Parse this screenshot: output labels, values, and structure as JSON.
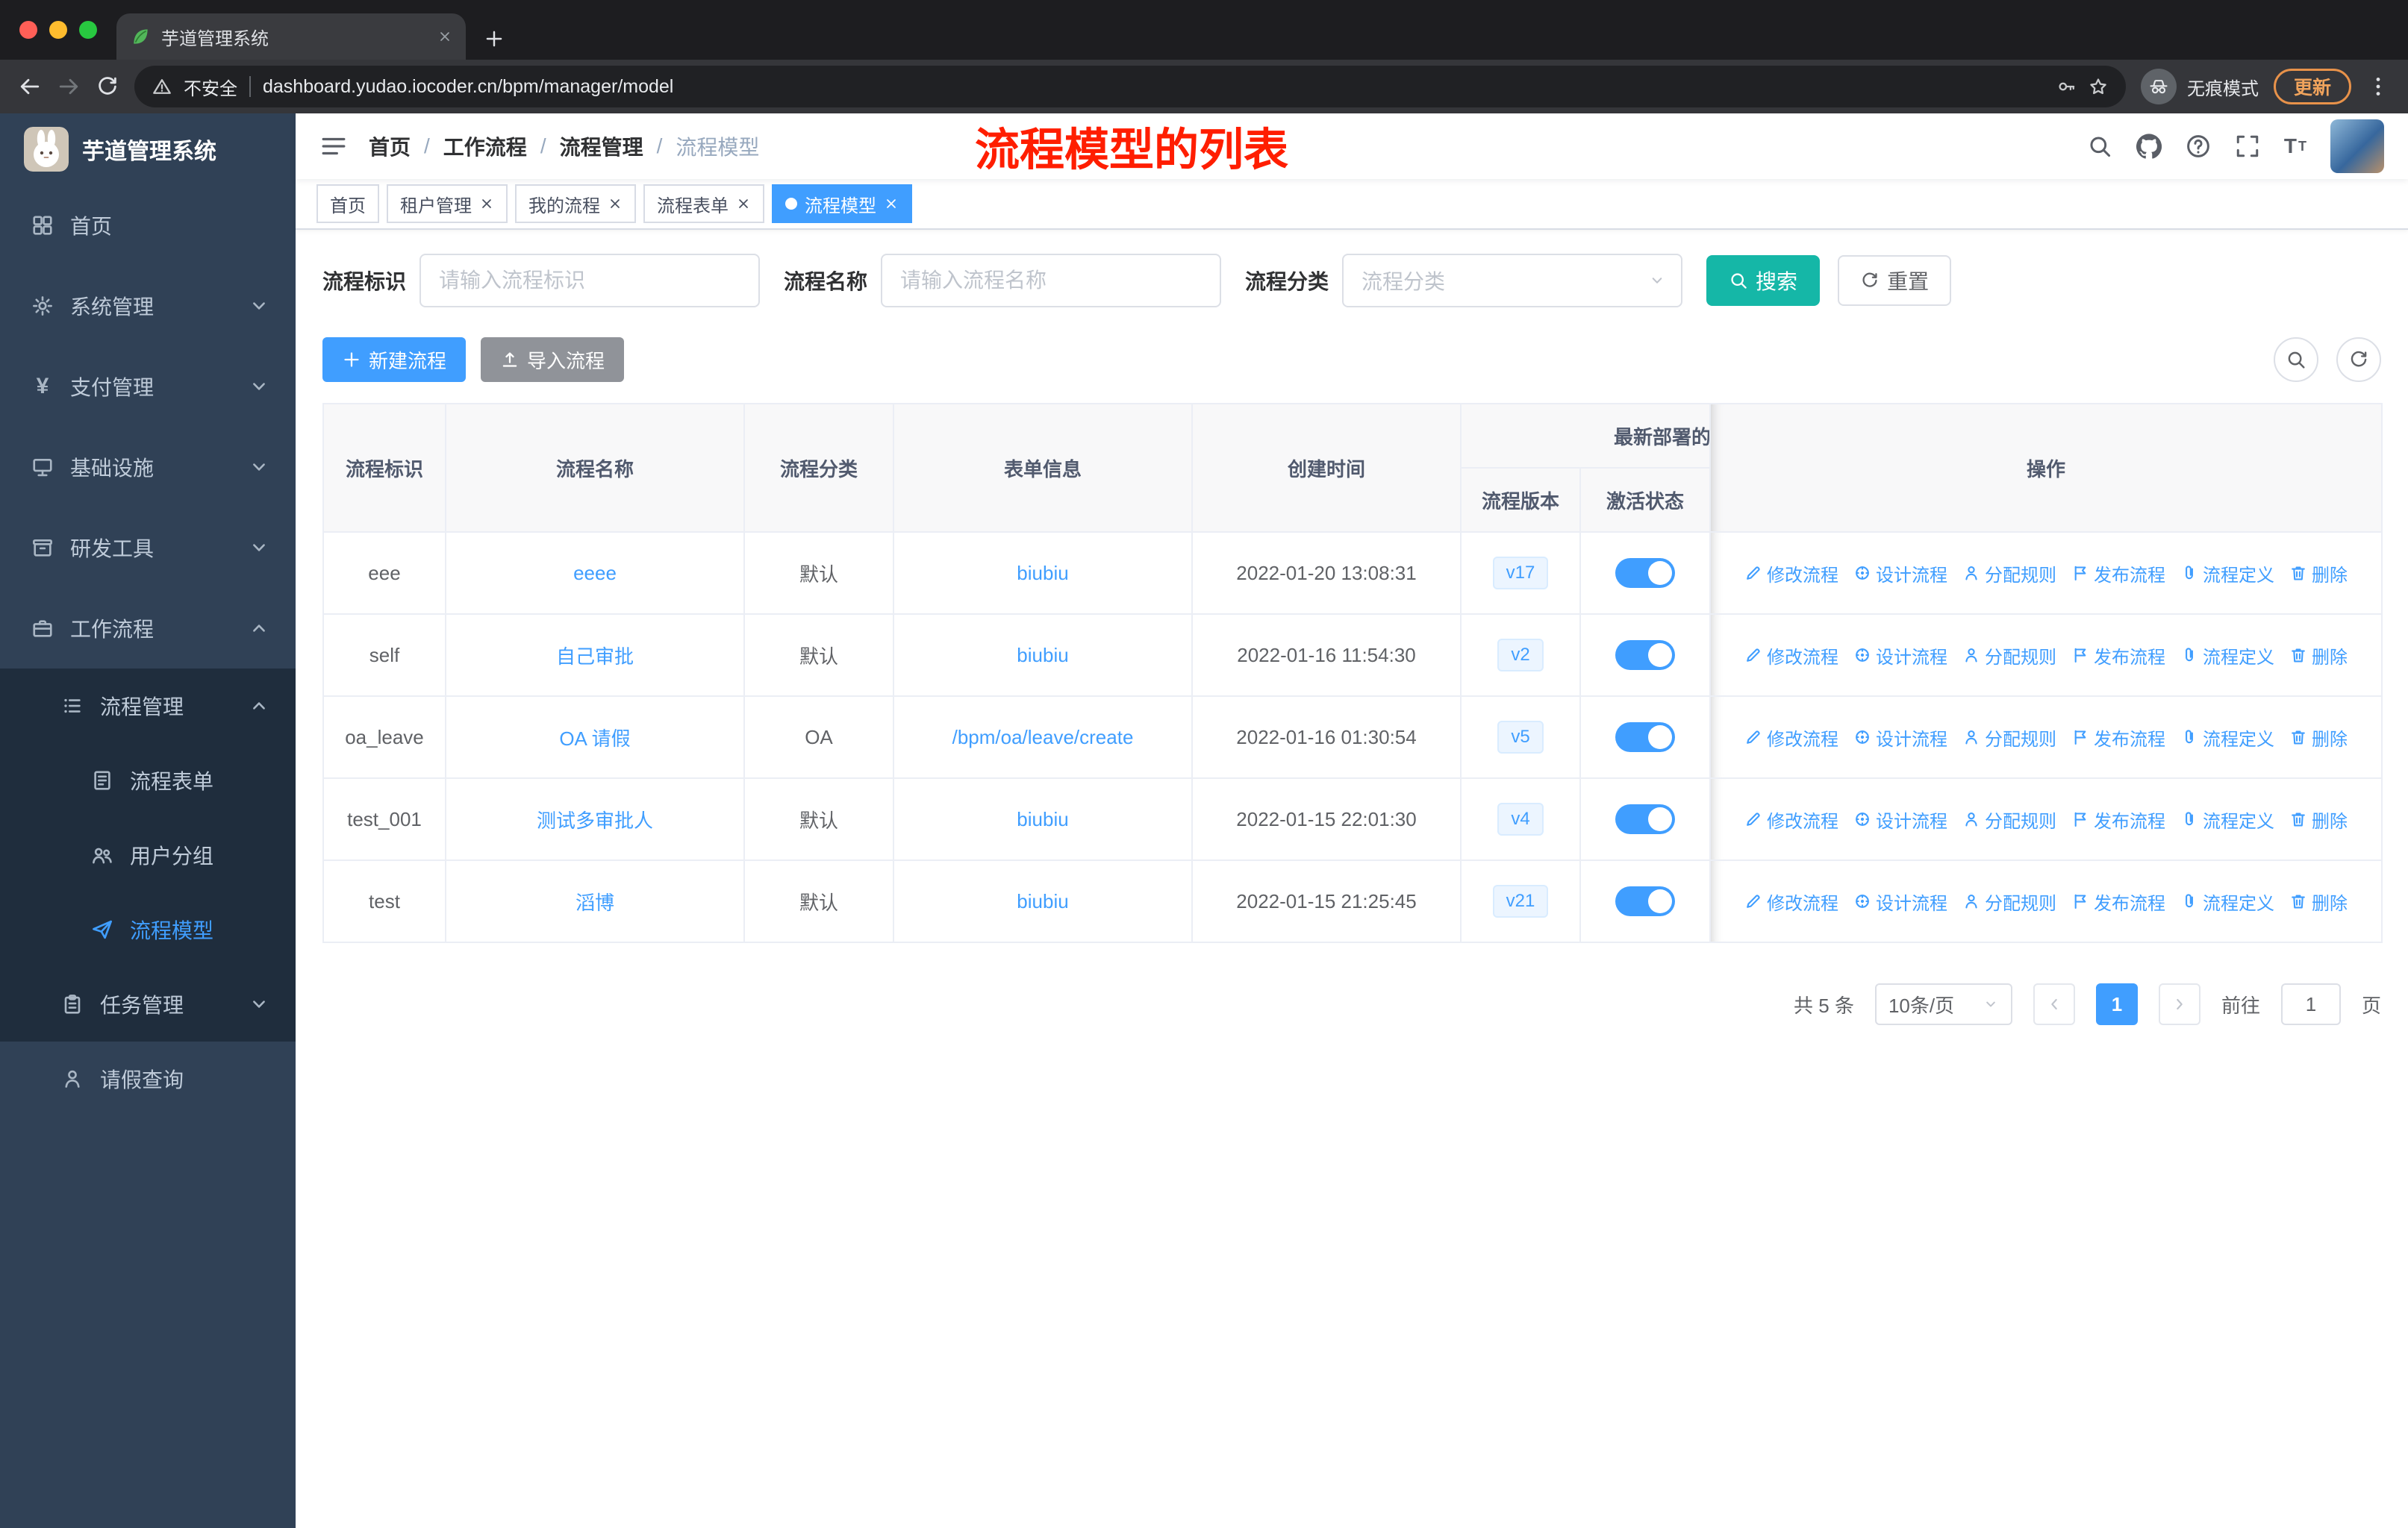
{
  "colors": {
    "accent": "#409eff",
    "search_button": "#15b7a7",
    "annotation_red": "#ff1e00",
    "sidebar_bg": "#304156",
    "submenu_bg": "#1f2d3d",
    "toggle_on": "#409eff",
    "tag_active": "#409eff"
  },
  "browser": {
    "tab_title": "芋道管理系统",
    "security_label": "不安全",
    "url": "dashboard.yudao.iocoder.cn/bpm/manager/model",
    "incognito_label": "无痕模式",
    "update_label": "更新"
  },
  "sidebar": {
    "logo_title": "芋道管理系统",
    "items": [
      {
        "key": "home",
        "label": "首页",
        "icon": "dashboard-icon",
        "level": 1
      },
      {
        "key": "system-management",
        "label": "系统管理",
        "icon": "gear-icon",
        "level": 1,
        "chevron": "down"
      },
      {
        "key": "payment-management",
        "label": "支付管理",
        "icon": "yen-icon",
        "level": 1,
        "chevron": "down"
      },
      {
        "key": "infrastructure",
        "label": "基础设施",
        "icon": "infra-icon",
        "level": 1,
        "chevron": "down"
      },
      {
        "key": "dev-tools",
        "label": "研发工具",
        "icon": "tools-icon",
        "level": 1,
        "chevron": "down"
      },
      {
        "key": "workflow",
        "label": "工作流程",
        "icon": "workflow-icon",
        "level": 1,
        "chevron": "up"
      },
      {
        "key": "process-management",
        "label": "流程管理",
        "icon": "process-icon",
        "level": 2,
        "dark": true,
        "chevron": "up"
      },
      {
        "key": "process-form",
        "label": "流程表单",
        "icon": "form-icon",
        "level": 3,
        "dark": true
      },
      {
        "key": "user-group",
        "label": "用户分组",
        "icon": "group-icon",
        "level": 3,
        "dark": true
      },
      {
        "key": "process-model",
        "label": "流程模型",
        "icon": "model-icon",
        "level": 3,
        "dark": true,
        "active": true
      },
      {
        "key": "task-management",
        "label": "任务管理",
        "icon": "task-icon",
        "level": 2,
        "dark": true,
        "chevron": "down"
      },
      {
        "key": "leave-query",
        "label": "请假查询",
        "icon": "person-icon",
        "level": 2
      }
    ]
  },
  "navbar": {
    "breadcrumb": [
      "首页",
      "工作流程",
      "流程管理",
      "流程模型"
    ],
    "annotation": "流程模型的列表"
  },
  "tags_bar": {
    "tags": [
      {
        "label": "首页",
        "closable": false,
        "active": false
      },
      {
        "label": "租户管理",
        "closable": true,
        "active": false
      },
      {
        "label": "我的流程",
        "closable": true,
        "active": false
      },
      {
        "label": "流程表单",
        "closable": true,
        "active": false
      },
      {
        "label": "流程模型",
        "closable": true,
        "active": true
      }
    ]
  },
  "filters": {
    "fields": [
      {
        "key": "process-id",
        "label": "流程标识",
        "placeholder": "请输入流程标识",
        "type": "input"
      },
      {
        "key": "process-name",
        "label": "流程名称",
        "placeholder": "请输入流程名称",
        "type": "input"
      },
      {
        "key": "process-category",
        "label": "流程分类",
        "placeholder": "流程分类",
        "type": "select"
      }
    ],
    "search_label": "搜索",
    "reset_label": "重置"
  },
  "toolbar": {
    "create_label": "新建流程",
    "import_label": "导入流程"
  },
  "table": {
    "columns": [
      "流程标识",
      "流程名称",
      "流程分类",
      "表单信息",
      "创建时间"
    ],
    "group_header": {
      "label": "最新部署的",
      "children": [
        "流程版本",
        "激活状态"
      ]
    },
    "actions_header": "操作",
    "row_actions": [
      {
        "key": "edit",
        "label": "修改流程",
        "icon": "edit-icon"
      },
      {
        "key": "design",
        "label": "设计流程",
        "icon": "design-icon"
      },
      {
        "key": "assign-rules",
        "label": "分配规则",
        "icon": "assign-icon"
      },
      {
        "key": "publish",
        "label": "发布流程",
        "icon": "publish-icon"
      },
      {
        "key": "definition",
        "label": "流程定义",
        "icon": "definition-icon"
      },
      {
        "key": "delete",
        "label": "删除",
        "icon": "delete-icon"
      }
    ],
    "rows": [
      {
        "id": "eee",
        "name": "eeee",
        "category": "默认",
        "form": "biubiu",
        "created": "2022-01-20 13:08:31",
        "version": "v17",
        "active": true
      },
      {
        "id": "self",
        "name": "自己审批",
        "category": "默认",
        "form": "biubiu",
        "created": "2022-01-16 11:54:30",
        "version": "v2",
        "active": true
      },
      {
        "id": "oa_leave",
        "name": "OA 请假",
        "category": "OA",
        "form": "/bpm/oa/leave/create",
        "created": "2022-01-16 01:30:54",
        "version": "v5",
        "active": true
      },
      {
        "id": "test_001",
        "name": "测试多审批人",
        "category": "默认",
        "form": "biubiu",
        "created": "2022-01-15 22:01:30",
        "version": "v4",
        "active": true
      },
      {
        "id": "test",
        "name": "滔博",
        "category": "默认",
        "form": "biubiu",
        "created": "2022-01-15 21:25:45",
        "version": "v21",
        "active": true
      }
    ]
  },
  "pagination": {
    "total_text": "共 5 条",
    "page_size": "10条/页",
    "current_page": "1",
    "goto_label": "前往",
    "goto_value": "1",
    "page_unit": "页"
  }
}
